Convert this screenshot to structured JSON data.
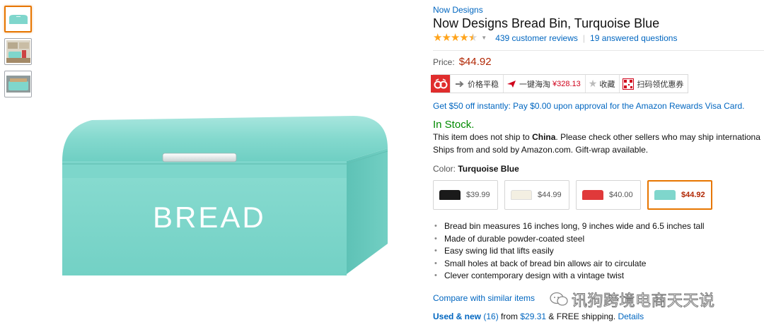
{
  "thumbnails": [
    {
      "alt": "bread-bin-front"
    },
    {
      "alt": "bread-bin-kitchen"
    },
    {
      "alt": "bread-bin-open"
    }
  ],
  "main_image": {
    "bread_label": "BREAD",
    "color": "#7fd6cc"
  },
  "product": {
    "brand": "Now Designs",
    "title": "Now Designs Bread Bin, Turquoise Blue",
    "rating": 4.5,
    "reviews": "439 customer reviews",
    "separator": "|",
    "questions": "19 answered questions"
  },
  "price": {
    "label": "Price:",
    "value": "$44.92"
  },
  "toolbar": {
    "price_trend": "价格平稳",
    "haitao": "一键海淘",
    "haitao_price": "¥328.13",
    "favorite": "收藏",
    "coupon": "扫码领优惠券"
  },
  "promo": "Get $50 off instantly: Pay $0.00 upon approval for the Amazon Rewards Visa Card.",
  "stock": "In Stock.",
  "shipping": {
    "note_prefix": "This item does not ship to ",
    "note_country": "China",
    "note_suffix": ". Please check other sellers who may ship internationa",
    "ships_from": "Ships from and sold by Amazon.com. Gift-wrap available."
  },
  "color": {
    "label": "Color:",
    "value": "Turquoise Blue"
  },
  "swatches": [
    {
      "price": "$39.99",
      "color": "#1a1a1a"
    },
    {
      "price": "$44.99",
      "color": "#f3efe2"
    },
    {
      "price": "$40.00",
      "color": "#e0393a"
    },
    {
      "price": "$44.92",
      "color": "#7fd6cc"
    }
  ],
  "bullets": [
    "Bread bin measures 16 inches long, 9 inches wide and 6.5 inches tall",
    "Made of durable powder-coated steel",
    "Easy swing lid that lifts easily",
    "Small holes at back of bread bin allows air to circulate",
    "Clever contemporary design with a vintage twist"
  ],
  "compare": "Compare with similar items",
  "used": {
    "label": "Used & new",
    "count": "(16)",
    "from": " from ",
    "price": "$29.31",
    "shipping": " & FREE shipping.",
    "details": "Details"
  },
  "watermark": "讯狗跨境电商天天说",
  "colors": {
    "link": "#0066c0",
    "price": "#b12704",
    "stock": "#008a00",
    "star": "#ffa41c",
    "selected_border": "#e77600"
  }
}
